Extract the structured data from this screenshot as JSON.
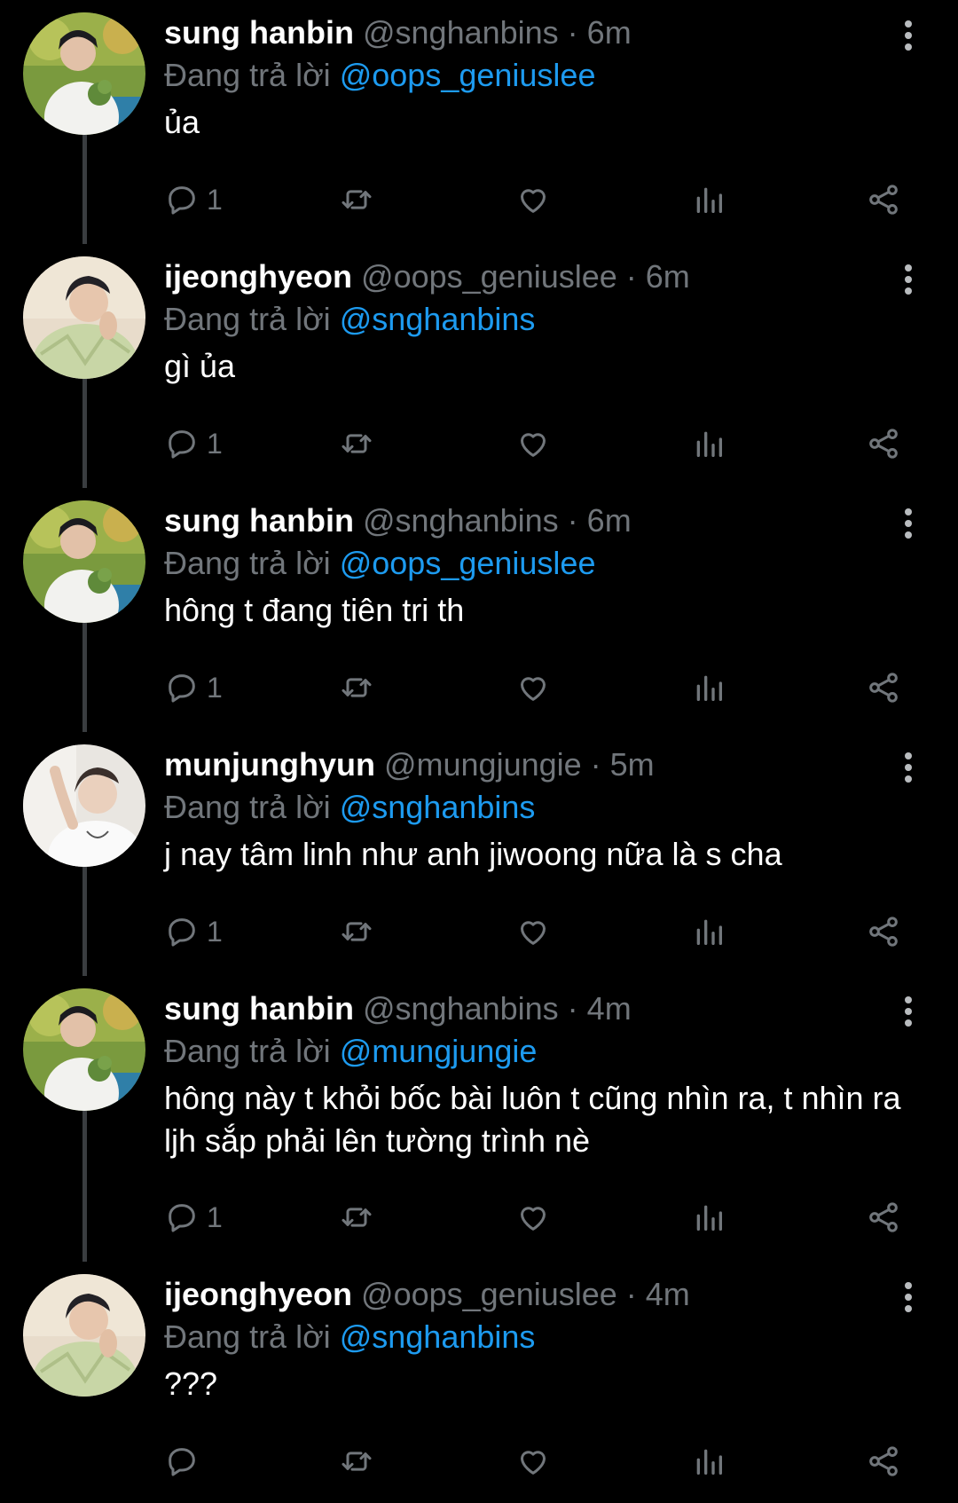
{
  "reply_prefix": "Đang trả lời",
  "tweets": [
    {
      "display_name": "sung hanbin",
      "handle": "@snghanbins",
      "time": "6m",
      "meta": " @snghanbins · 6m",
      "reply_to": "@oops_geniuslee",
      "text": "ủa",
      "reply_count": "1"
    },
    {
      "display_name": "ijeonghyeon",
      "handle": "@oops_geniuslee",
      "time": "6m",
      "meta": " @oops_geniuslee · 6m",
      "reply_to": "@snghanbins",
      "text": "gì ủa",
      "reply_count": "1"
    },
    {
      "display_name": "sung hanbin",
      "handle": "@snghanbins",
      "time": "6m",
      "meta": " @snghanbins · 6m",
      "reply_to": "@oops_geniuslee",
      "text": "hông t đang tiên tri th",
      "reply_count": "1"
    },
    {
      "display_name": "munjunghyun",
      "handle": "@mungjungie",
      "time": "5m",
      "meta": " @mungjungie · 5m",
      "reply_to": "@snghanbins",
      "text": "j nay tâm linh như anh jiwoong nữa là s cha",
      "reply_count": "1"
    },
    {
      "display_name": "sung hanbin",
      "handle": "@snghanbins",
      "time": "4m",
      "meta": " @snghanbins · 4m",
      "reply_to": "@mungjungie",
      "text": "hông này t khỏi bốc bài luôn t cũng nhìn ra, t nhìn ra ljh sắp phải lên tường trình nè",
      "reply_count": "1"
    },
    {
      "display_name": "ijeonghyeon",
      "handle": "@oops_geniuslee",
      "time": "4m",
      "meta": " @oops_geniuslee · 4m",
      "reply_to": "@snghanbins",
      "text": "???",
      "reply_count": ""
    }
  ],
  "colors": {
    "background": "#000000",
    "name": "#ffffff",
    "muted": "#71767b",
    "mention": "#1d9bf0",
    "thread_line": "#3a3d40"
  },
  "icons": {
    "reply": "comment-bubble-icon",
    "retweet": "retweet-arrows-icon",
    "like": "heart-outline-icon",
    "views": "bar-chart-icon",
    "share": "share-nodes-icon",
    "more": "vertical-ellipsis-icon"
  }
}
